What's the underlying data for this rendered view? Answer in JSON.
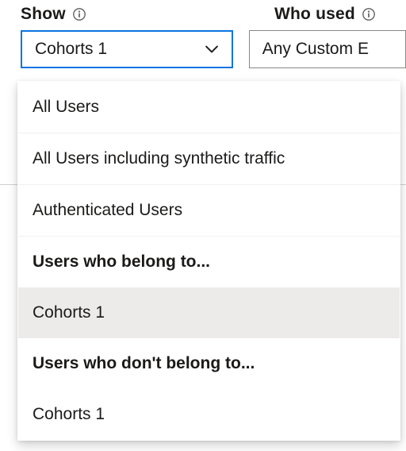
{
  "filters": {
    "show": {
      "label": "Show",
      "selected": "Cohorts 1",
      "options": [
        {
          "label": "All Users",
          "kind": "option"
        },
        {
          "label": "All Users including synthetic traffic",
          "kind": "option"
        },
        {
          "label": "Authenticated Users",
          "kind": "option"
        },
        {
          "label": "Users who belong to...",
          "kind": "header"
        },
        {
          "label": "Cohorts 1",
          "kind": "selected"
        },
        {
          "label": "Users who don't belong to...",
          "kind": "header"
        },
        {
          "label": "Cohorts 1",
          "kind": "option"
        }
      ]
    },
    "who_used": {
      "label": "Who used",
      "selected": "Any Custom E"
    }
  },
  "colors": {
    "focus_border": "#0b74e2",
    "neutral_border": "#8a8886",
    "selected_bg": "#edebe9"
  }
}
